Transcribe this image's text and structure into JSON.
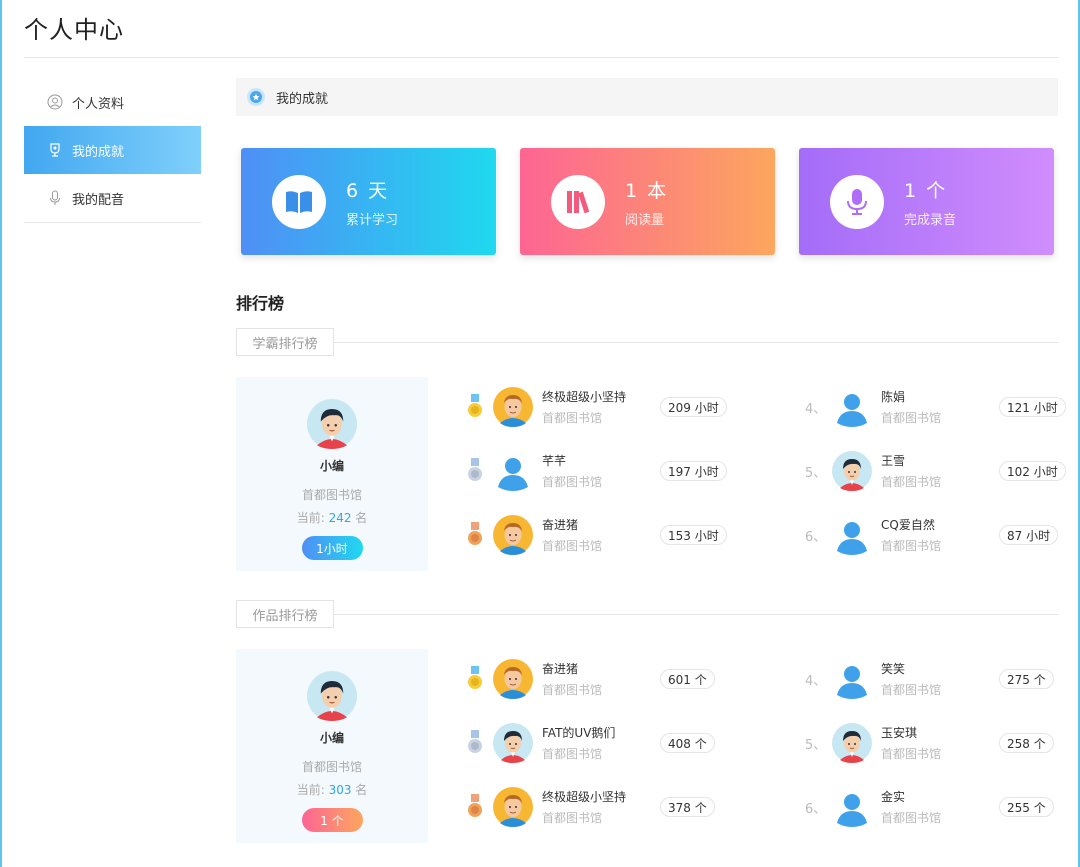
{
  "header": {
    "title": "个人中心"
  },
  "sidebar": {
    "items": [
      {
        "label": "个人资料",
        "icon": "user-icon",
        "active": false
      },
      {
        "label": "我的成就",
        "icon": "trophy-icon",
        "active": true
      },
      {
        "label": "我的配音",
        "icon": "microphone-icon",
        "active": false
      }
    ]
  },
  "section": {
    "title": "我的成就"
  },
  "stats": [
    {
      "value": "6 天",
      "label": "累计学习",
      "icon": "book-icon"
    },
    {
      "value": "1 本",
      "label": "阅读量",
      "icon": "books-icon"
    },
    {
      "value": "1 个",
      "label": "完成录音",
      "icon": "microphone-icon"
    }
  ],
  "ranking": {
    "title": "排行榜",
    "study": {
      "tab": "学霸排行榜",
      "me": {
        "name": "小编",
        "library": "首都图书馆",
        "rank_prefix": "当前: ",
        "rank": "242",
        "rank_suffix": " 名",
        "value": "1小时"
      },
      "entries": [
        {
          "rank": "1",
          "name": "终极超级小坚持",
          "library": "首都图书馆",
          "value": "209 小时"
        },
        {
          "rank": "2",
          "name": "芊芊",
          "library": "首都图书馆",
          "value": "197 小时"
        },
        {
          "rank": "3",
          "name": "奋进猪",
          "library": "首都图书馆",
          "value": "153 小时"
        },
        {
          "rank": "4、",
          "name": "陈娟",
          "library": "首都图书馆",
          "value": "121 小时"
        },
        {
          "rank": "5、",
          "name": "王雪",
          "library": "首都图书馆",
          "value": "102 小时"
        },
        {
          "rank": "6、",
          "name": "CQ爱自然",
          "library": "首都图书馆",
          "value": "87 小时"
        }
      ]
    },
    "works": {
      "tab": "作品排行榜",
      "me": {
        "name": "小编",
        "library": "首都图书馆",
        "rank_prefix": "当前: ",
        "rank": "303",
        "rank_suffix": " 名",
        "value": "1 个"
      },
      "entries": [
        {
          "rank": "1",
          "name": "奋进猪",
          "library": "首都图书馆",
          "value": "601 个"
        },
        {
          "rank": "2",
          "name": "FAT的UV鹅们",
          "library": "首都图书馆",
          "value": "408 个"
        },
        {
          "rank": "3",
          "name": "终极超级小坚持",
          "library": "首都图书馆",
          "value": "378 个"
        },
        {
          "rank": "4、",
          "name": "笑笑",
          "library": "首都图书馆",
          "value": "275 个"
        },
        {
          "rank": "5、",
          "name": "玉安琪",
          "library": "首都图书馆",
          "value": "258 个"
        },
        {
          "rank": "6、",
          "name": "金实",
          "library": "首都图书馆",
          "value": "255 个"
        }
      ]
    }
  },
  "colors": {
    "accent": "#42a7f0",
    "blue_card": "#4f8ff5",
    "pink_card": "#fd6593",
    "purple_card": "#a46cf8",
    "highlight": "#2ea7e8"
  }
}
